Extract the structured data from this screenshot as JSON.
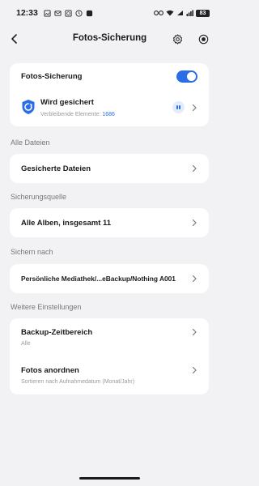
{
  "status_bar": {
    "time": "12:33",
    "battery": "83"
  },
  "header": {
    "title": "Fotos-Sicherung"
  },
  "backup_card": {
    "toggle_label": "Fotos-Sicherung",
    "toggle_on": true,
    "status_title": "Wird gesichert",
    "remaining_label": "Verbleibende Elemente:",
    "remaining_count": "1686"
  },
  "sections": {
    "all_files": {
      "title": "Alle Dateien",
      "row_label": "Gesicherte Dateien"
    },
    "source": {
      "title": "Sicherungsquelle",
      "row_label": "Alle Alben, insgesamt 11"
    },
    "destination": {
      "title": "Sichern nach",
      "row_label": "Persönliche Mediathek/...eBackup/Nothing A001"
    },
    "more": {
      "title": "Weitere Einstellungen",
      "time_range_label": "Backup-Zeitbereich",
      "time_range_value": "Alle",
      "sort_label": "Fotos anordnen",
      "sort_value": "Sortieren nach Aufnahmedatum (Monat/Jahr)"
    }
  },
  "colors": {
    "accent": "#2b6de6",
    "background": "#f2f2f4",
    "card": "#ffffff"
  }
}
